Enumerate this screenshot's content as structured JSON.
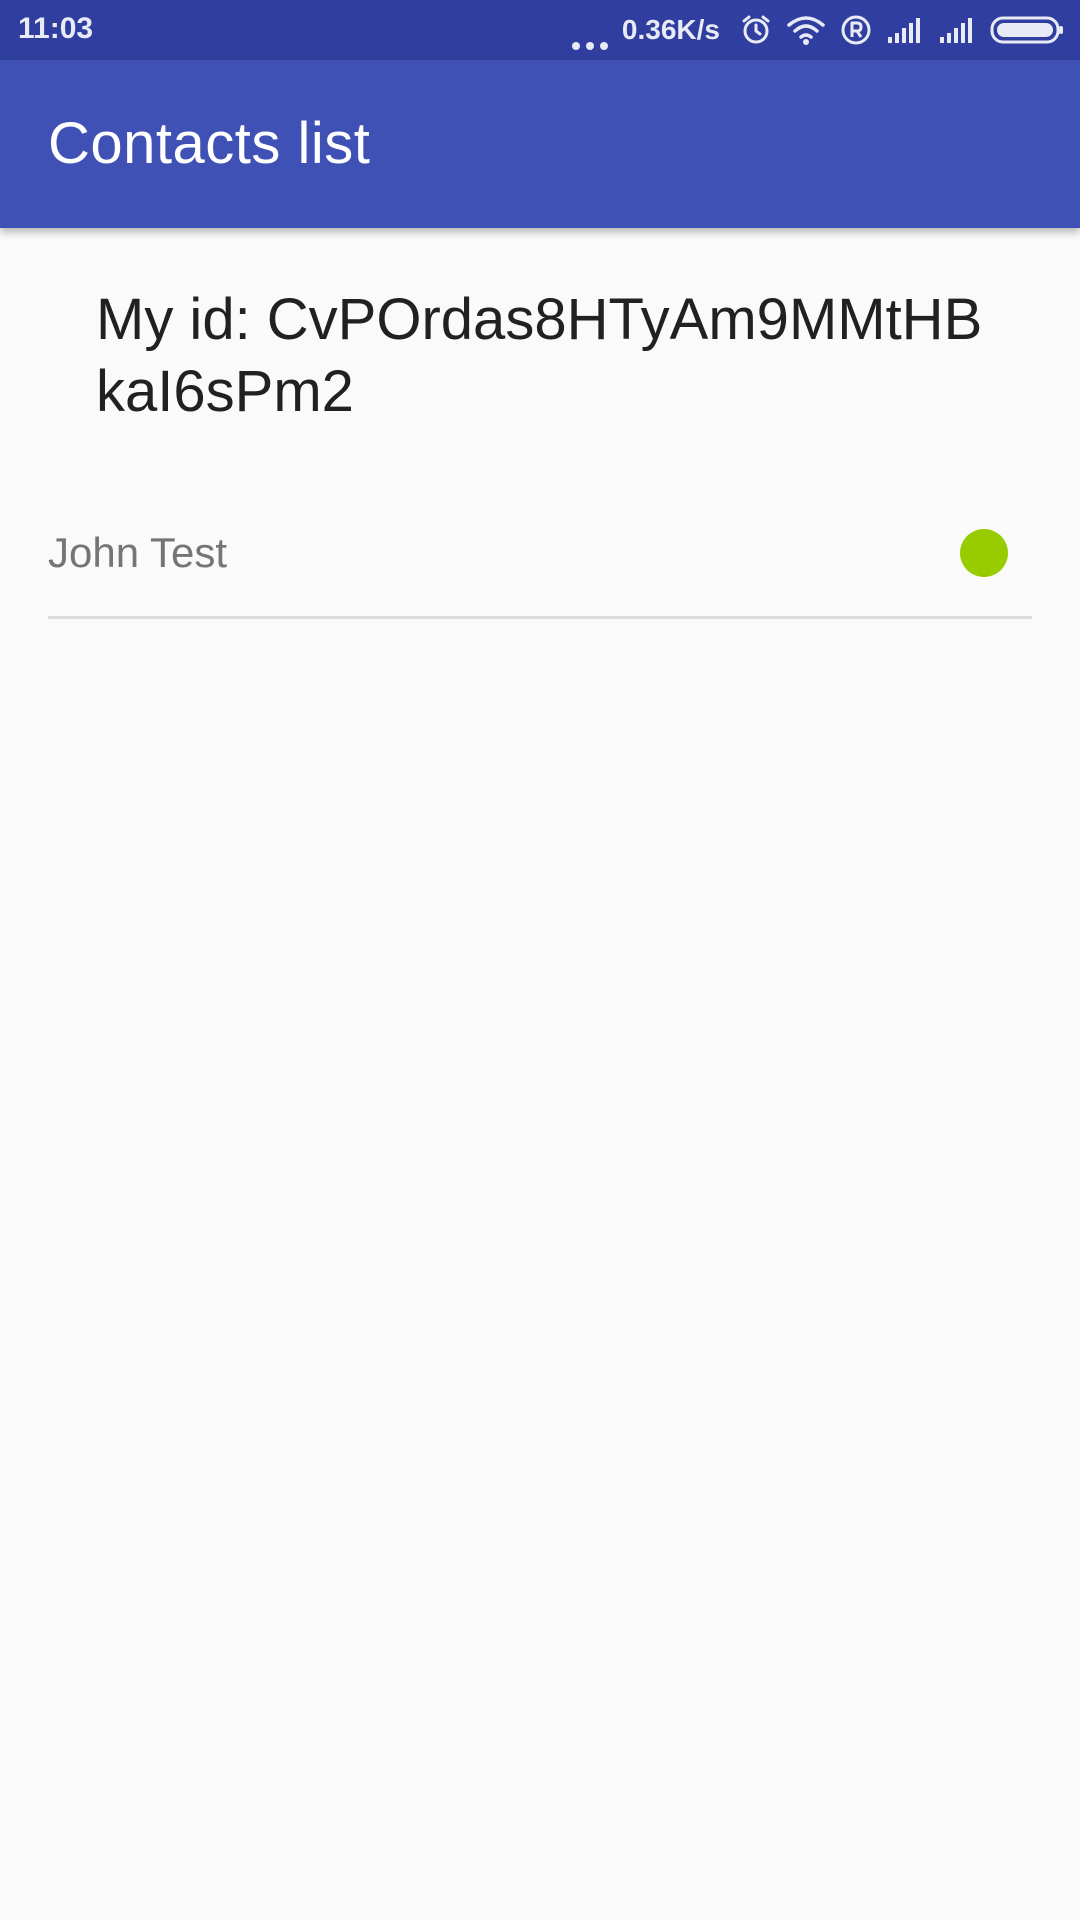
{
  "status_bar": {
    "time": "11:03",
    "network_speed": "0.36K/s",
    "icons": [
      "more-dots-icon",
      "alarm-icon",
      "wifi-icon",
      "registered-icon",
      "signal-icon",
      "signal-icon",
      "battery-icon"
    ]
  },
  "app_bar": {
    "title": "Contacts list",
    "color": "#3f51b5"
  },
  "main": {
    "my_id_label": "My id: CvPOrdas8HTyAm9MMtHBkaI6sPm2",
    "contacts": [
      {
        "name": "John Test",
        "status": "online",
        "status_color": "#99cc00"
      }
    ]
  }
}
